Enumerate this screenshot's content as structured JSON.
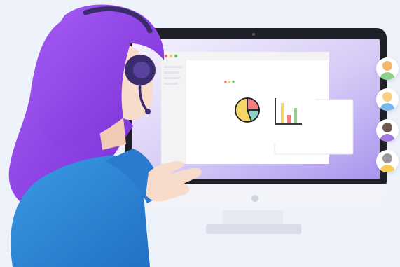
{
  "scene": {
    "monitor": {
      "window_controls": [
        "close-dot",
        "minimize-dot",
        "maximize-dot"
      ],
      "dialog": {
        "window_controls": [
          "close-dot",
          "minimize-dot",
          "maximize-dot"
        ],
        "icons": [
          "pie-chart-icon",
          "bar-chart-icon"
        ]
      }
    },
    "avatars": [
      {
        "name": "avatar-1",
        "hair": "#f4b66b",
        "shirt": "#8fd18a"
      },
      {
        "name": "avatar-2",
        "hair": "#f6cf83",
        "shirt": "#7ab8f0"
      },
      {
        "name": "avatar-3",
        "hair": "#6b5b53",
        "shirt": "#a57be0"
      },
      {
        "name": "avatar-4",
        "hair": "#9a9a9a",
        "shirt": "#f5cf55"
      }
    ],
    "colors": {
      "background": "#eef2fb",
      "screen_gradient_top": "#f3eefc",
      "screen_gradient_bottom": "#b8a6f0",
      "hair": "#8b3fe6",
      "headset": "#3b2c6d",
      "shirt": "#2f86d6",
      "skin": "#f7dccb",
      "pie_red": "#f07f7f",
      "pie_yellow": "#f6d665",
      "pie_teal": "#8fd1c4",
      "bar_yellow": "#f6d665",
      "bar_red": "#f07f7f",
      "bar_green": "#8fd18a"
    }
  }
}
